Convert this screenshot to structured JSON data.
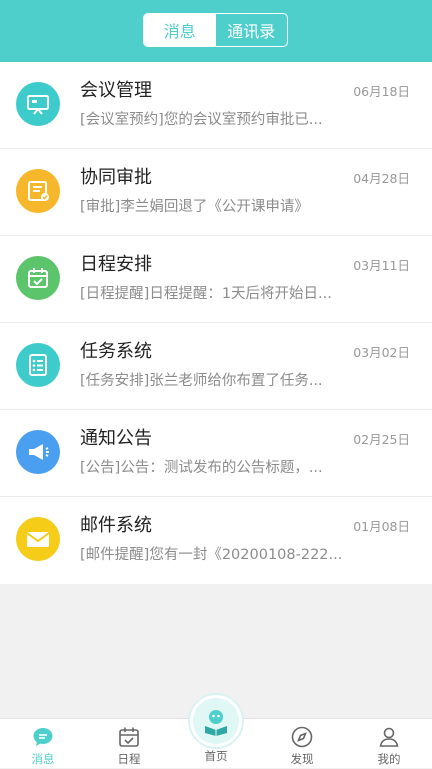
{
  "header": {
    "tabs": [
      {
        "label": "消息",
        "active": true
      },
      {
        "label": "通讯录",
        "active": false
      }
    ]
  },
  "messages": [
    {
      "icon": "meeting-board-icon",
      "color": "#3ecbcb",
      "title": "会议管理",
      "date": "06月18日",
      "preview": "[会议室预约]您的会议室预约审批已..."
    },
    {
      "icon": "approval-document-icon",
      "color": "#f7b72a",
      "title": "协同审批",
      "date": "04月28日",
      "preview": "[审批]李兰娟回退了《公开课申请》"
    },
    {
      "icon": "calendar-check-icon",
      "color": "#5cc46a",
      "title": "日程安排",
      "date": "03月11日",
      "preview": "[日程提醒]日程提醒：1天后将开始日..."
    },
    {
      "icon": "task-list-icon",
      "color": "#3ecbcb",
      "title": "任务系统",
      "date": "03月02日",
      "preview": "[任务安排]张兰老师给你布置了任务..."
    },
    {
      "icon": "megaphone-icon",
      "color": "#4a9ff0",
      "title": "通知公告",
      "date": "02月25日",
      "preview": "[公告]公告：测试发布的公告标题，..."
    },
    {
      "icon": "envelope-icon",
      "color": "#f5cc18",
      "title": "邮件系统",
      "date": "01月08日",
      "preview": "[邮件提醒]您有一封《20200108-222..."
    }
  ],
  "tabbar": {
    "items": [
      {
        "label": "消息",
        "icon": "chat-bubble-icon",
        "active": true
      },
      {
        "label": "日程",
        "icon": "calendar-icon",
        "active": false
      },
      {
        "label": "首页",
        "icon": "home-logo-icon",
        "active": false
      },
      {
        "label": "发现",
        "icon": "compass-icon",
        "active": false
      },
      {
        "label": "我的",
        "icon": "user-icon",
        "active": false
      }
    ]
  },
  "accent_color": "#4ecfcc"
}
